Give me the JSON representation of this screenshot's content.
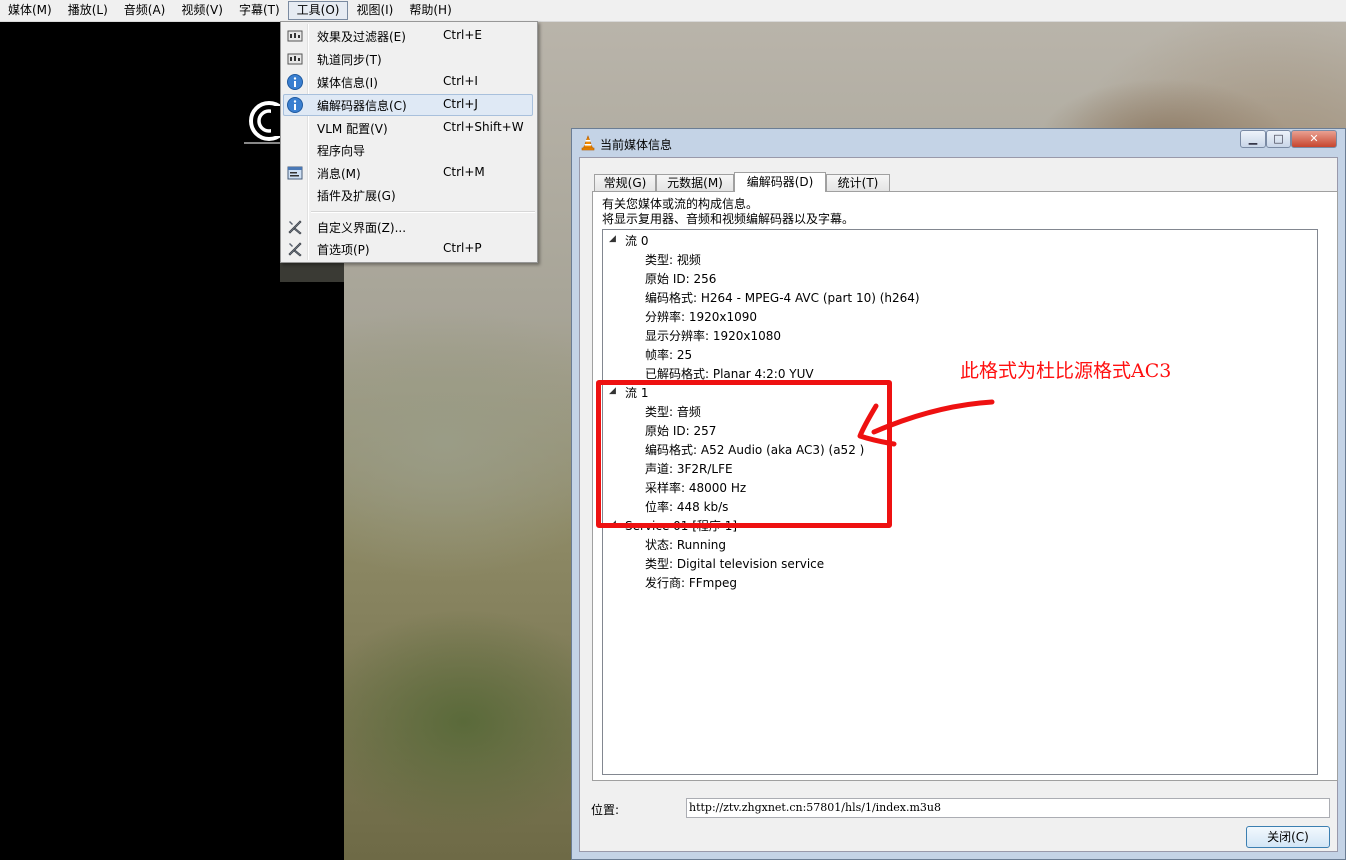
{
  "menubar": {
    "items": [
      {
        "label": "媒体(M)"
      },
      {
        "label": "播放(L)"
      },
      {
        "label": "音频(A)"
      },
      {
        "label": "视频(V)"
      },
      {
        "label": "字幕(T)"
      },
      {
        "label": "工具(O)",
        "active": true
      },
      {
        "label": "视图(I)"
      },
      {
        "label": "帮助(H)"
      }
    ]
  },
  "tools_menu": {
    "items": [
      {
        "label": "效果及过滤器(E)",
        "shortcut": "Ctrl+E",
        "icon": "effects-icon"
      },
      {
        "label": "轨道同步(T)",
        "shortcut": "",
        "icon": "sync-icon"
      },
      {
        "label": "媒体信息(I)",
        "shortcut": "Ctrl+I",
        "icon": "info-icon"
      },
      {
        "label": "编解码器信息(C)",
        "shortcut": "Ctrl+J",
        "icon": "info-icon",
        "highlighted": true
      },
      {
        "label": "VLM 配置(V)",
        "shortcut": "Ctrl+Shift+W",
        "icon": ""
      },
      {
        "label": "程序向导",
        "shortcut": "",
        "icon": ""
      },
      {
        "label": "消息(M)",
        "shortcut": "Ctrl+M",
        "icon": "messages-icon"
      },
      {
        "label": "插件及扩展(G)",
        "shortcut": "",
        "icon": ""
      },
      {
        "label": "自定义界面(Z)...",
        "shortcut": "",
        "icon": "tools-icon"
      },
      {
        "label": "首选项(P)",
        "shortcut": "Ctrl+P",
        "icon": "tools-icon"
      }
    ]
  },
  "dialog": {
    "title": "当前媒体信息",
    "window_buttons": {
      "minimize": "▁",
      "maximize": "□",
      "close": "✕"
    },
    "tabs": [
      {
        "label": "常规(G)"
      },
      {
        "label": "元数据(M)"
      },
      {
        "label": "编解码器(D)",
        "selected": true
      },
      {
        "label": "统计(T)"
      }
    ],
    "description_line1": "有关您媒体或流的构成信息。",
    "description_line2": "将显示复用器、音频和视频编解码器以及字幕。",
    "tree": {
      "stream0": {
        "label": "流 0",
        "rows": [
          "类型: 视频",
          "原始 ID: 256",
          "编码格式: H264 - MPEG-4 AVC (part 10) (h264)",
          "分辨率: 1920x1090",
          "显示分辨率: 1920x1080",
          "帧率: 25",
          "已解码格式: Planar 4:2:0 YUV"
        ]
      },
      "stream1": {
        "label": "流 1",
        "rows": [
          "类型: 音频",
          "原始 ID: 257",
          "编码格式: A52 Audio (aka AC3) (a52 )",
          "声道: 3F2R/LFE",
          "采样率: 48000 Hz",
          "位率: 448 kb/s"
        ]
      },
      "service": {
        "label": "Service 01 [程序 1]",
        "rows": [
          "状态: Running",
          "类型: Digital television service",
          "发行商: FFmpeg"
        ]
      }
    },
    "location_label": "位置:",
    "location_value": "http://ztv.zhgxnet.cn:57801/hls/1/index.m3u8",
    "close_label": "关闭(C)"
  },
  "annotation": {
    "text": "此格式为杜比源格式AC3",
    "color": "#ee1111"
  },
  "colors": {
    "menu_highlight": "#dfe9f5",
    "dialog_frame": "#c4d3e6"
  }
}
